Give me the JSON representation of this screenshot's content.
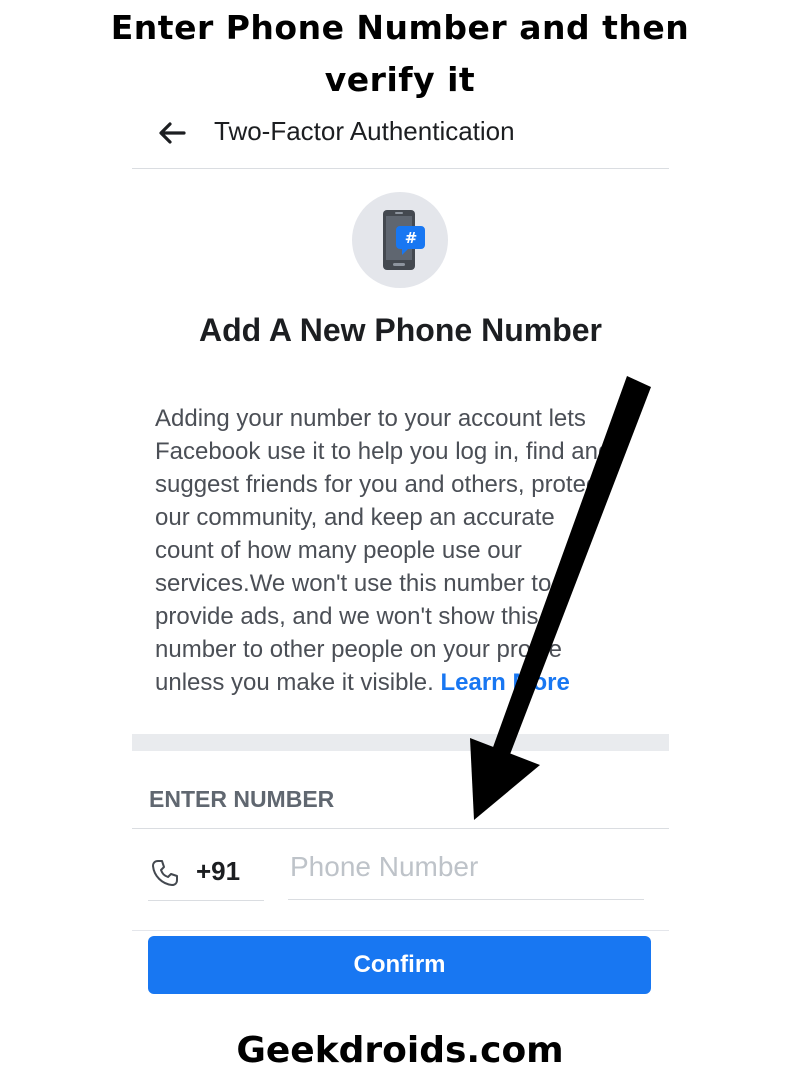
{
  "caption": {
    "line1": "Enter Phone Number and then",
    "line2": "verify it"
  },
  "header": {
    "back_icon": "back-arrow-icon",
    "title": "Two-Factor Authentication"
  },
  "main": {
    "icon": "phone-hash-icon",
    "heading": "Add A New Phone Number",
    "description_lines": [
      "Adding your number to your account lets",
      "Facebook use it to help you log in, find and",
      "suggest friends for you and others, protect",
      "our community, and keep an accurate",
      "count of how many people use our",
      "services.We won't use this number to",
      "provide ads, and we won't show this",
      "number to other people on your profile",
      "unless you make it visible."
    ],
    "learn_more": "Learn More"
  },
  "form": {
    "section_label": "ENTER NUMBER",
    "phone_icon": "phone-handset-icon",
    "country_code": "+91",
    "phone_placeholder": "Phone Number",
    "phone_value": "",
    "confirm_label": "Confirm"
  },
  "annotation": {
    "icon": "pointer-arrow-icon"
  },
  "footer": {
    "watermark": "Geekdroids.com"
  },
  "colors": {
    "accent": "#1877f2",
    "icon_circle": "#e4e6eb",
    "text_secondary": "#606770"
  }
}
